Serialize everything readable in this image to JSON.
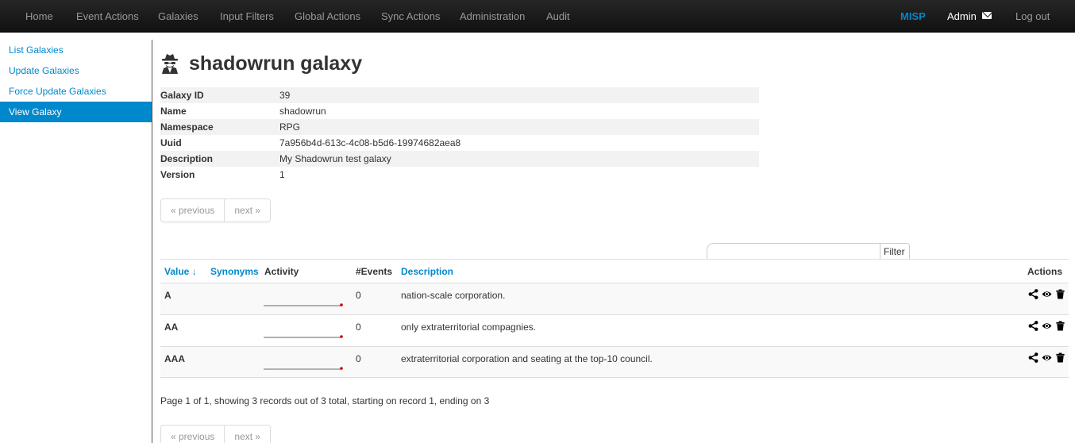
{
  "nav": {
    "items": [
      "Home",
      "Event Actions",
      "Galaxies",
      "Input Filters",
      "Global Actions",
      "Sync Actions",
      "Administration",
      "Audit"
    ],
    "brand": "MISP",
    "user": "Admin",
    "logout": "Log out"
  },
  "sidebar": {
    "items": [
      {
        "label": "List Galaxies"
      },
      {
        "label": "Update Galaxies"
      },
      {
        "label": "Force Update Galaxies"
      },
      {
        "label": "View Galaxy",
        "active": true
      }
    ]
  },
  "page": {
    "title": "shadowrun galaxy",
    "icon": "user-secret-icon"
  },
  "details": [
    {
      "key": "Galaxy ID",
      "value": "39"
    },
    {
      "key": "Name",
      "value": "shadowrun"
    },
    {
      "key": "Namespace",
      "value": "RPG"
    },
    {
      "key": "Uuid",
      "value": "7a956b4d-613c-4c08-b5d6-19974682aea8"
    },
    {
      "key": "Description",
      "value": "My Shadowrun test galaxy"
    },
    {
      "key": "Version",
      "value": "1"
    }
  ],
  "pagination": {
    "previous": "« previous",
    "next": "next »"
  },
  "filter": {
    "label": "Filter",
    "value": ""
  },
  "table": {
    "headers": {
      "value": "Value ↓",
      "synonyms": "Synonyms",
      "activity": "Activity",
      "events": "#Events",
      "description": "Description",
      "actions": "Actions"
    },
    "rows": [
      {
        "value": "A",
        "events": "0",
        "description": "nation-scale corporation."
      },
      {
        "value": "AA",
        "events": "0",
        "description": "only extraterritorial compagnies."
      },
      {
        "value": "AAA",
        "events": "0",
        "description": "extraterritorial corporation and seating at the top-10 council."
      }
    ]
  },
  "page_info": "Page 1 of 1, showing 3 records out of 3 total, starting on record 1, ending on 3",
  "colors": {
    "accent": "#0088cc",
    "navbar": "#1b1b1b",
    "spark_dot": "#cc0000"
  }
}
